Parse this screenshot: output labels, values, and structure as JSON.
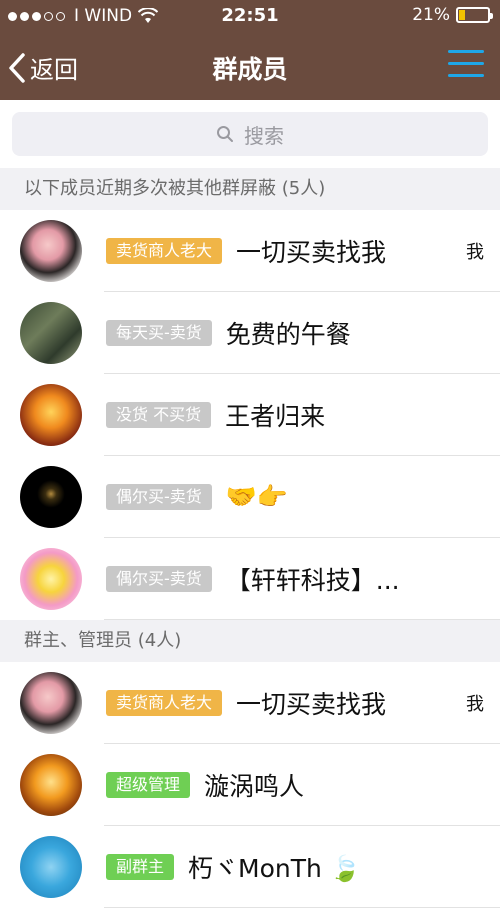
{
  "status": {
    "carrier": "I WIND",
    "time": "22:51",
    "battery": "21%",
    "battery_fraction": 0.21
  },
  "nav": {
    "back_label": "返回",
    "title": "群成员"
  },
  "search": {
    "placeholder": "搜索"
  },
  "sections": [
    {
      "header": "以下成员近期多次被其他群屏蔽 (5人)",
      "members": [
        {
          "tag": "卖货商人老大",
          "tag_color": "gold",
          "name": "一切买卖找我",
          "me": "我"
        },
        {
          "tag": "每天买-卖货",
          "tag_color": "gray",
          "name": "免费的午餐",
          "me": ""
        },
        {
          "tag": "没货 不买货",
          "tag_color": "gray",
          "name": "王者归来",
          "me": ""
        },
        {
          "tag": "偶尔买-卖货",
          "tag_color": "gray",
          "name": "🤝👉",
          "me": ""
        },
        {
          "tag": "偶尔买-卖货",
          "tag_color": "gray",
          "name": "【轩轩科技】...",
          "me": ""
        }
      ]
    },
    {
      "header": "群主、管理员 (4人)",
      "members": [
        {
          "tag": "卖货商人老大",
          "tag_color": "gold",
          "name": "一切买卖找我",
          "me": "我"
        },
        {
          "tag": "超级管理",
          "tag_color": "green",
          "name": "漩涡鸣人",
          "me": ""
        },
        {
          "tag": "副群主",
          "tag_color": "green",
          "name": "朽ヾMonTh 🍃",
          "me": ""
        }
      ]
    }
  ],
  "colors": {
    "bar": "#6a4b3e",
    "accent": "#1ea7e8",
    "gold_tag": "#f0b547",
    "gray_tag": "#c8c8c8",
    "green_tag": "#6fcf54"
  }
}
